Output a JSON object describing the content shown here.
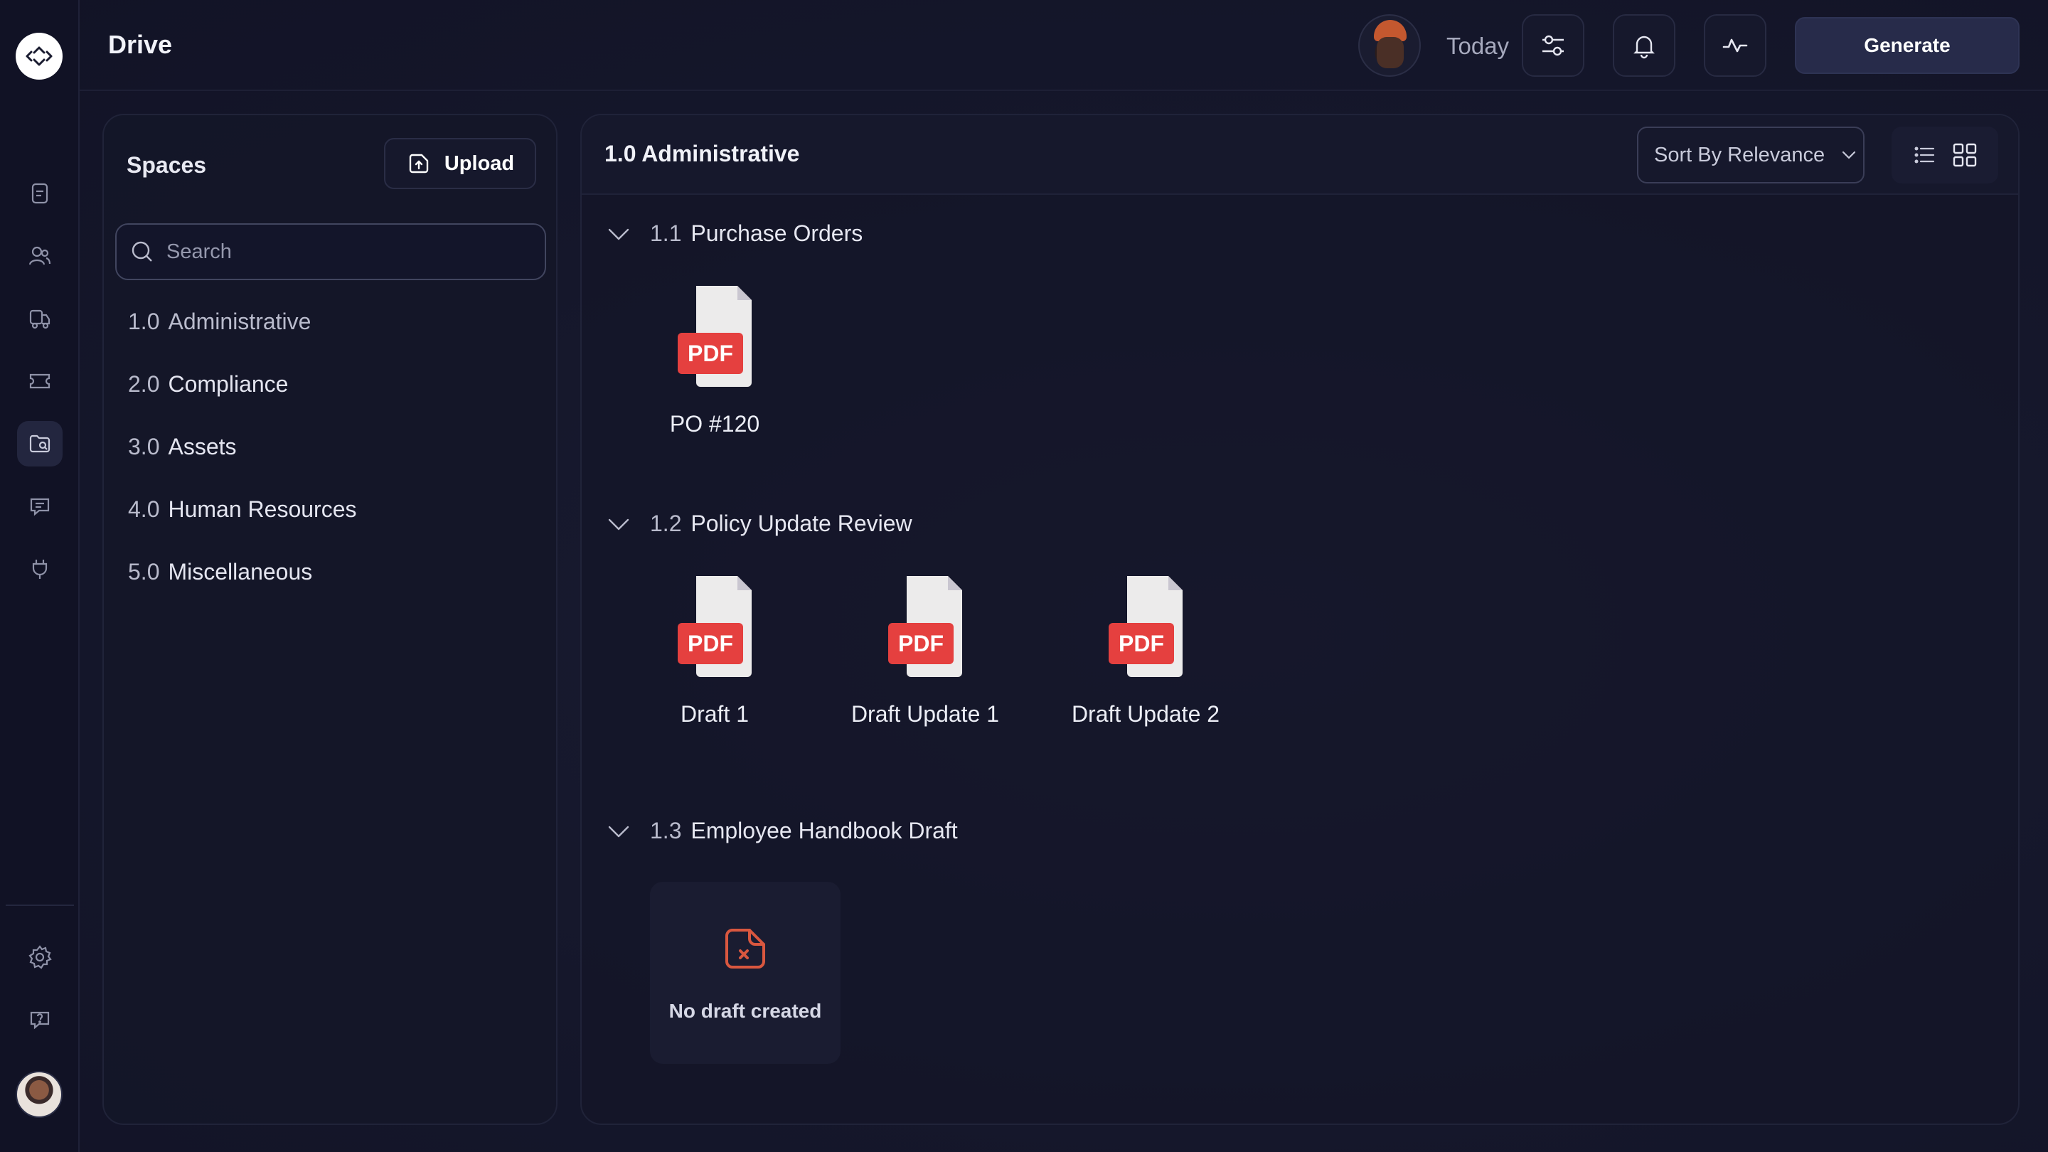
{
  "header": {
    "title": "Drive",
    "date_label": "Today",
    "generate_label": "Generate"
  },
  "spaces": {
    "title": "Spaces",
    "upload_label": "Upload",
    "search_placeholder": "Search",
    "items": [
      {
        "num": "1.0",
        "label": "Administrative"
      },
      {
        "num": "2.0",
        "label": "Compliance"
      },
      {
        "num": "3.0",
        "label": "Assets"
      },
      {
        "num": "4.0",
        "label": "Human Resources"
      },
      {
        "num": "5.0",
        "label": "Miscellaneous"
      }
    ]
  },
  "main": {
    "title": "1.0 Administrative",
    "sort_label": "Sort By Relevance",
    "sections": [
      {
        "num": "1.1",
        "label": "Purchase Orders",
        "files": [
          {
            "name": "PO #120",
            "badge": "PDF"
          }
        ]
      },
      {
        "num": "1.2",
        "label": "Policy Update Review",
        "files": [
          {
            "name": "Draft 1",
            "badge": "PDF"
          },
          {
            "name": "Draft Update 1",
            "badge": "PDF"
          },
          {
            "name": "Draft Update 2",
            "badge": "PDF"
          }
        ]
      },
      {
        "num": "1.3",
        "label": "Employee Handbook Draft",
        "empty_message": "No draft created"
      }
    ]
  },
  "icons": {
    "rail": [
      "logo-icon",
      "document-icon",
      "users-icon",
      "truck-icon",
      "ticket-icon",
      "folder-icon",
      "chat-icon",
      "plug-icon",
      "settings-icon",
      "help-icon"
    ],
    "header": [
      "filter-icon",
      "bell-icon",
      "activity-icon"
    ]
  },
  "colors": {
    "background": "#14162a",
    "pdf_badge": "#e5403f",
    "accent_button": "#272b4a",
    "empty_icon": "#d9573f"
  }
}
